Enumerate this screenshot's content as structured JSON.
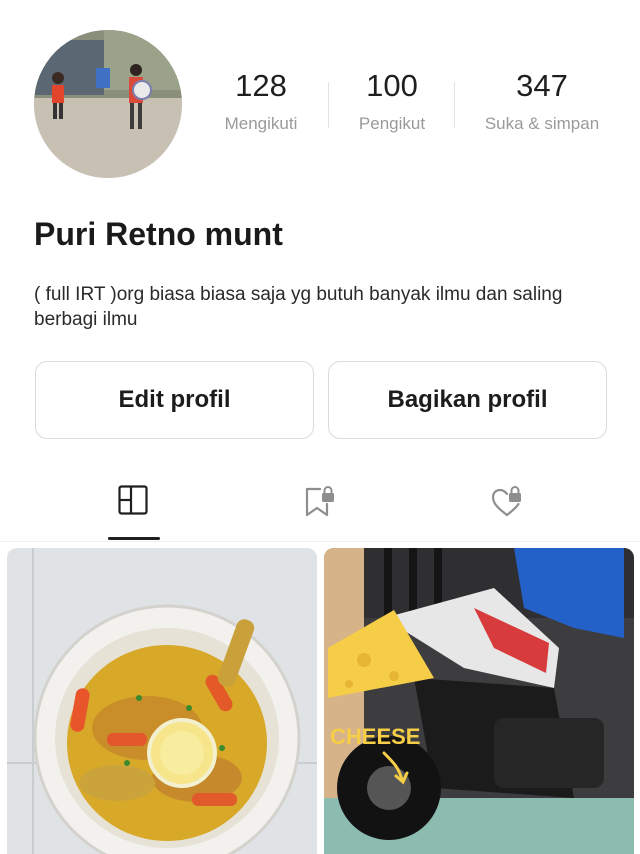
{
  "profile": {
    "name": "Puri Retno munt",
    "bio": "( full IRT )org biasa biasa saja yg butuh banyak ilmu dan saling berbagi ilmu"
  },
  "stats": [
    {
      "value": "128",
      "label": "Mengikuti"
    },
    {
      "value": "100",
      "label": "Pengikut"
    },
    {
      "value": "347",
      "label": "Suka & simpan"
    }
  ],
  "actions": {
    "edit_label": "Edit profil",
    "share_label": "Bagikan profil"
  },
  "tabs": [
    {
      "icon": "grid-icon",
      "active": true
    },
    {
      "icon": "locked-bookmark-icon",
      "active": false
    },
    {
      "icon": "locked-heart-icon",
      "active": false
    }
  ],
  "posts": [
    {
      "description": "soup-bowl-photo"
    },
    {
      "description": "motorbike-photo",
      "overlay_text": "CHEESE"
    }
  ],
  "colors": {
    "text": "#1f1f1f",
    "muted": "#9a9a9a",
    "border": "#dadada",
    "accent_cheese": "#f5cd47"
  }
}
